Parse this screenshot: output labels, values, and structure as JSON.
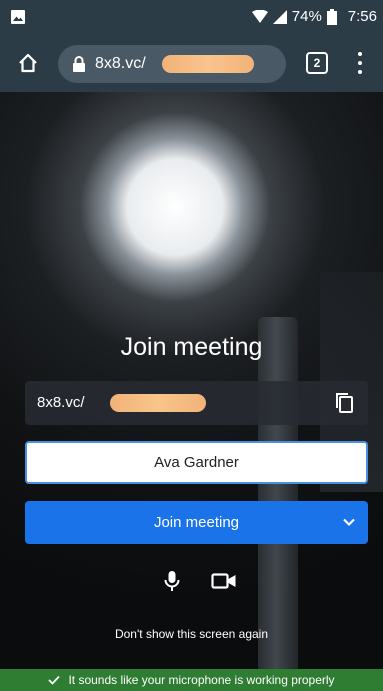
{
  "status_bar": {
    "battery": "74%",
    "time": "7:56"
  },
  "browser": {
    "url": "8x8.vc/",
    "tab_count": "2"
  },
  "meeting": {
    "title": "Join meeting",
    "link": "8x8.vc/",
    "name_value": "Ava Gardner",
    "join_label": "Join meeting",
    "dont_show": "Don't show this screen again"
  },
  "banner": {
    "text": "It sounds like your microphone is working properly",
    "color": "#2e7d32"
  },
  "accent": "#1a73e8"
}
